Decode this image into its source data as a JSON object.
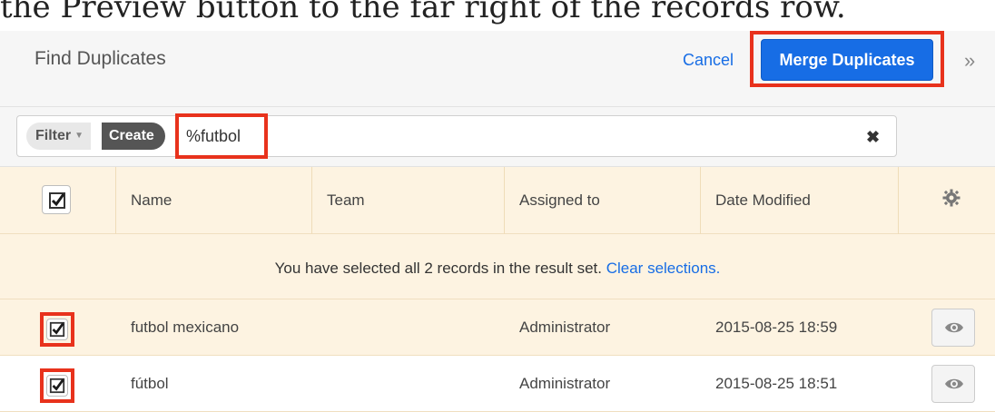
{
  "caption": "the Preview button to the far right of the records row.",
  "header": {
    "title": "Find Duplicates",
    "cancel_label": "Cancel",
    "merge_label": "Merge Duplicates",
    "expand_icon": "double-chevron-right-icon"
  },
  "filter": {
    "dropdown_label": "Filter",
    "create_label": "Create",
    "search_value": "%futbol",
    "clear_icon": "close-icon"
  },
  "table": {
    "columns": [
      "Name",
      "Team",
      "Assigned to",
      "Date Modified"
    ],
    "settings_icon": "gear-icon",
    "notice_text": "You have selected all 2 records in the result set.",
    "notice_link": "Clear selections.",
    "rows": [
      {
        "name": "futbol mexicano",
        "team": "",
        "assigned_to": "Administrator",
        "date_modified": "2015-08-25 18:59",
        "checked": true,
        "preview_icon": "eye-icon"
      },
      {
        "name": "fútbol",
        "team": "",
        "assigned_to": "Administrator",
        "date_modified": "2015-08-25 18:51",
        "checked": true,
        "preview_icon": "eye-icon"
      }
    ]
  },
  "colors": {
    "accent": "#176de5",
    "highlight_border": "#e8321c",
    "selected_row": "#fdf3e1"
  }
}
